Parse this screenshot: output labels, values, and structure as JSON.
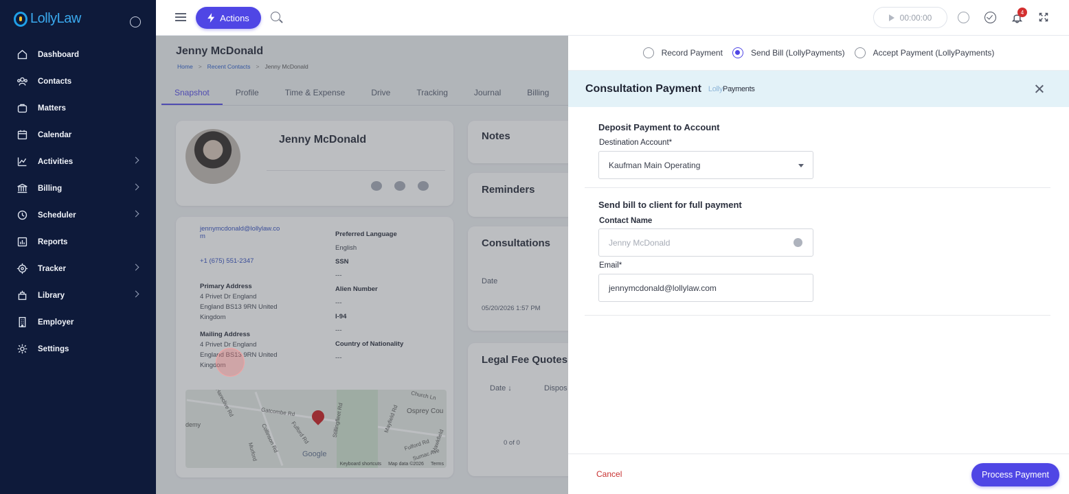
{
  "app": {
    "logo_text": "LollyLaw"
  },
  "sidebar": {
    "items": [
      {
        "label": "Dashboard",
        "icon": "home-icon",
        "has_children": false
      },
      {
        "label": "Contacts",
        "icon": "people-icon",
        "has_children": false
      },
      {
        "label": "Matters",
        "icon": "briefcase-icon",
        "has_children": false
      },
      {
        "label": "Calendar",
        "icon": "calendar-icon",
        "has_children": false
      },
      {
        "label": "Activities",
        "icon": "chart-line-icon",
        "has_children": true
      },
      {
        "label": "Billing",
        "icon": "bank-icon",
        "has_children": true
      },
      {
        "label": "Scheduler",
        "icon": "clock-icon",
        "has_children": true
      },
      {
        "label": "Reports",
        "icon": "bar-chart-icon",
        "has_children": false
      },
      {
        "label": "Tracker",
        "icon": "target-icon",
        "has_children": true
      },
      {
        "label": "Library",
        "icon": "library-icon",
        "has_children": true
      },
      {
        "label": "Employer",
        "icon": "building-icon",
        "has_children": false
      },
      {
        "label": "Settings",
        "icon": "gear-icon",
        "has_children": false
      }
    ]
  },
  "topbar": {
    "actions_label": "Actions",
    "timer": "00:00:00",
    "notification_count": "4",
    "icons": [
      "menu-icon",
      "bolt-icon",
      "search-icon",
      "play-icon",
      "stopwatch-icon",
      "check-circle-icon",
      "bell-icon",
      "expand-icon"
    ]
  },
  "contact_page": {
    "title": "Jenny McDonald",
    "breadcrumbs": [
      "Home",
      "Recent Contacts",
      "Jenny McDonald"
    ],
    "tabs": [
      "Snapshot",
      "Profile",
      "Time & Expense",
      "Drive",
      "Tracking",
      "Journal",
      "Billing"
    ],
    "active_tab": "Snapshot",
    "profile_name": "Jenny McDonald",
    "email": "jennymcdonald@lollylaw.co",
    "email_wrap": "m",
    "phone": "+1 (675) 551-2347",
    "primary_address_label": "Primary Address",
    "primary_address": [
      "4 Privet Dr England",
      "England BS13 9RN United",
      "Kingdom"
    ],
    "mailing_address_label": "Mailing Address",
    "mailing_address": [
      "4 Privet Dr England",
      "England BS13 9RN United",
      "Kingdom"
    ],
    "preferred_language_label": "Preferred Language",
    "preferred_language": "English",
    "ssn_label": "SSN",
    "ssn": "---",
    "alien_number_label": "Alien Number",
    "alien_number": "---",
    "i94_label": "I-94",
    "i94": "---",
    "country_label": "Country of Nationality",
    "country": "---",
    "map": {
      "streets": [
        "Gatcombe Rd",
        "Fulford Rd",
        "Collinson Rd",
        "Stillingfleet Rd",
        "Mayfield Rd",
        "Osprey Cou",
        "Murford",
        "Hareclive Rd",
        "demy",
        "Fulford Rd",
        "Church Ln",
        "Hawkfield",
        "Sumac Ave"
      ],
      "attribution": [
        "Keyboard shortcuts",
        "Map data ©2026",
        "Terms"
      ],
      "google_label": "Google"
    },
    "notes_title": "Notes",
    "reminders_title": "Reminders",
    "consultations_title": "Consultations",
    "consultations_date_header": "Date",
    "consultations_date": "05/20/2026 1:57 PM",
    "legal_fee_title": "Legal Fee Quotes",
    "legal_fee_headers": [
      "Date ↓",
      "Dispos"
    ],
    "pager": "0 of 0"
  },
  "panel": {
    "radio_options": [
      {
        "label": "Record Payment",
        "selected": false
      },
      {
        "label": "Send Bill (LollyPayments)",
        "selected": true
      },
      {
        "label": "Accept Payment (LollyPayments)",
        "selected": false
      }
    ],
    "title": "Consultation Payment",
    "brand_prefix": "Lolly",
    "brand_suffix": "Payments",
    "deposit_section_title": "Deposit Payment to Account",
    "destination_label": "Destination Account*",
    "destination_value": "Kaufman Main Operating",
    "send_bill_title": "Send bill to client for full payment",
    "contact_name_label": "Contact Name",
    "contact_name_placeholder": "Jenny McDonald",
    "email_label": "Email*",
    "email_value": "jennymcdonald@lollylaw.com",
    "cancel_label": "Cancel",
    "process_label": "Process Payment"
  },
  "colors": {
    "sidebar_bg": "#0e1a3a",
    "accent": "#4f46e5",
    "panel_header_bg": "#e3f2f8",
    "cancel": "#c8302f"
  }
}
